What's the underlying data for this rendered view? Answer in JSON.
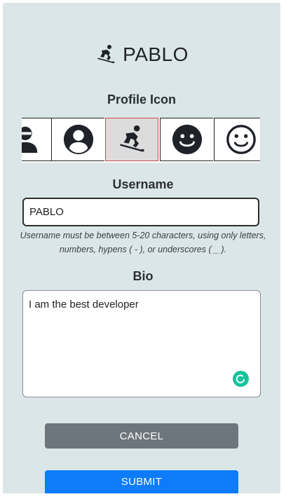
{
  "header": {
    "title": "PABLO",
    "icon": "snowboarding-icon"
  },
  "profile_icon": {
    "label": "Profile Icon",
    "options": [
      {
        "icon": "user-minus-icon",
        "selected": false
      },
      {
        "icon": "user-circle-icon",
        "selected": false
      },
      {
        "icon": "snowboarding-icon",
        "selected": true
      },
      {
        "icon": "smile-solid-icon",
        "selected": false
      },
      {
        "icon": "smile-outline-icon",
        "selected": false
      }
    ],
    "selected_color": "#c94a4a"
  },
  "username": {
    "label": "Username",
    "value": "PABLO",
    "hint": "Username must be between 5-20 characters, using only letters, numbers, hypens ( - ), or underscores ( _ )."
  },
  "bio": {
    "label": "Bio",
    "value": "I am the best developer",
    "grammar_badge_color": "#15c39a"
  },
  "actions": {
    "cancel_label": "CANCEL",
    "submit_label": "SUBMIT",
    "cancel_color": "#6d757d",
    "submit_color": "#0d7bfa"
  }
}
